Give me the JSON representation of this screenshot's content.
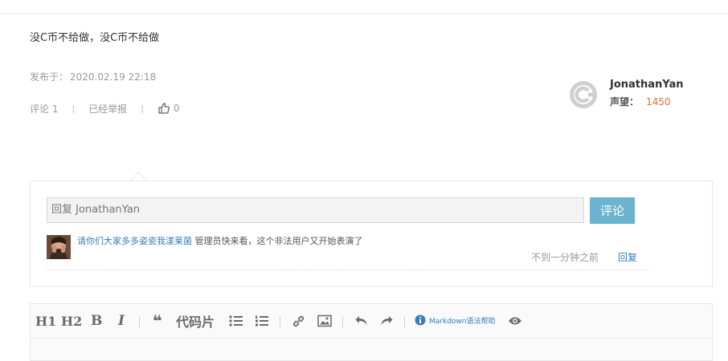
{
  "post": {
    "title": "没C币不给做，没C币不给做",
    "posted_label": "发布于：",
    "posted_time": "2020.02.19 22:18",
    "comments_label": "评论 1",
    "report_label": "已经举报",
    "likes": "0",
    "separator": "|"
  },
  "author": {
    "name": "JonathanYan",
    "rep_label": "声望：",
    "rep_value": "1450",
    "avatar_icon": "c-logo-icon"
  },
  "reply_form": {
    "placeholder": "回复 JonathanYan",
    "submit_label": "评论"
  },
  "comments": [
    {
      "user": "请你们大家多多姿瓷我漾莱菌",
      "text": " 管理员快来看，这个非法用户又开始表演了",
      "time": "不到一分钟之前",
      "reply_label": "回复"
    }
  ],
  "editor": {
    "toolbar": {
      "h1": "H1",
      "h2": "H2",
      "bold": "B",
      "italic": "I",
      "quote": "❝",
      "code": "代码片",
      "markdown_help": "Markdown语法帮助"
    }
  },
  "colors": {
    "accent": "#6cb3cf",
    "link": "#3a7bbd",
    "reputation": "#e96b3a"
  }
}
